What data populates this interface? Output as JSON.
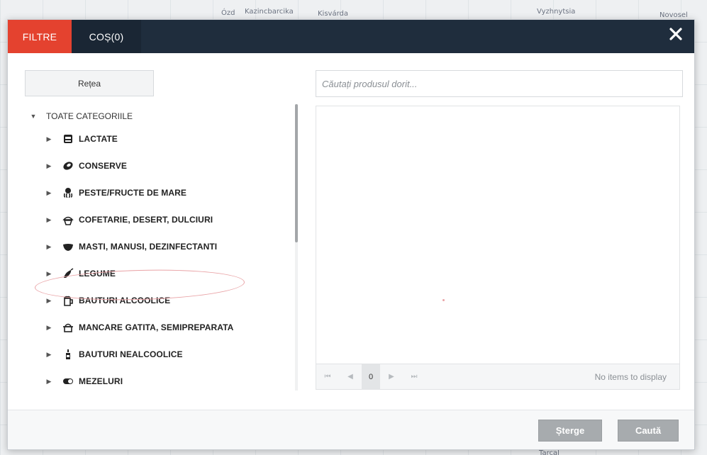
{
  "map": {
    "labels": [
      "Ózd",
      "Kazincbarcika",
      "Kisvárda",
      "Vyzhnytsia",
      "Novosel"
    ],
    "bottom_labels": [
      "Tarcal"
    ]
  },
  "header": {
    "tab_filters": "FILTRE",
    "tab_cart": "COȘ(0)",
    "close_icon": "×"
  },
  "left": {
    "network_button": "Rețea",
    "tree_root": "TOATE CATEGORIILE",
    "categories": [
      {
        "label": "LACTATE",
        "icon": "dairy-icon"
      },
      {
        "label": "CONSERVE",
        "icon": "canned-food-icon"
      },
      {
        "label": "PESTE/FRUCTE DE MARE",
        "icon": "octopus-icon"
      },
      {
        "label": "COFETARIE, DESERT, DULCIURI",
        "icon": "cupcake-icon"
      },
      {
        "label": "MASTI, MANUSI, DEZINFECTANTI",
        "icon": "mask-icon"
      },
      {
        "label": "LEGUME",
        "icon": "vegetable-icon"
      },
      {
        "label": "BAUTURI ALCOOLICE",
        "icon": "beer-icon"
      },
      {
        "label": "MANCARE GATITA, SEMIPREPARATA",
        "icon": "cooking-pot-icon"
      },
      {
        "label": "BAUTURI NEALCOOLICE",
        "icon": "bottle-icon"
      },
      {
        "label": "MEZELURI",
        "icon": "salami-icon"
      }
    ]
  },
  "right": {
    "search_placeholder": "Căutați produsul dorit...",
    "pager": {
      "page": "0",
      "info": "No items to display"
    }
  },
  "footer": {
    "clear_button": "Șterge",
    "search_button": "Caută"
  },
  "colors": {
    "header_bg": "#1f2d3d",
    "active_tab": "#e4422f",
    "button_gray": "#a7abae"
  }
}
